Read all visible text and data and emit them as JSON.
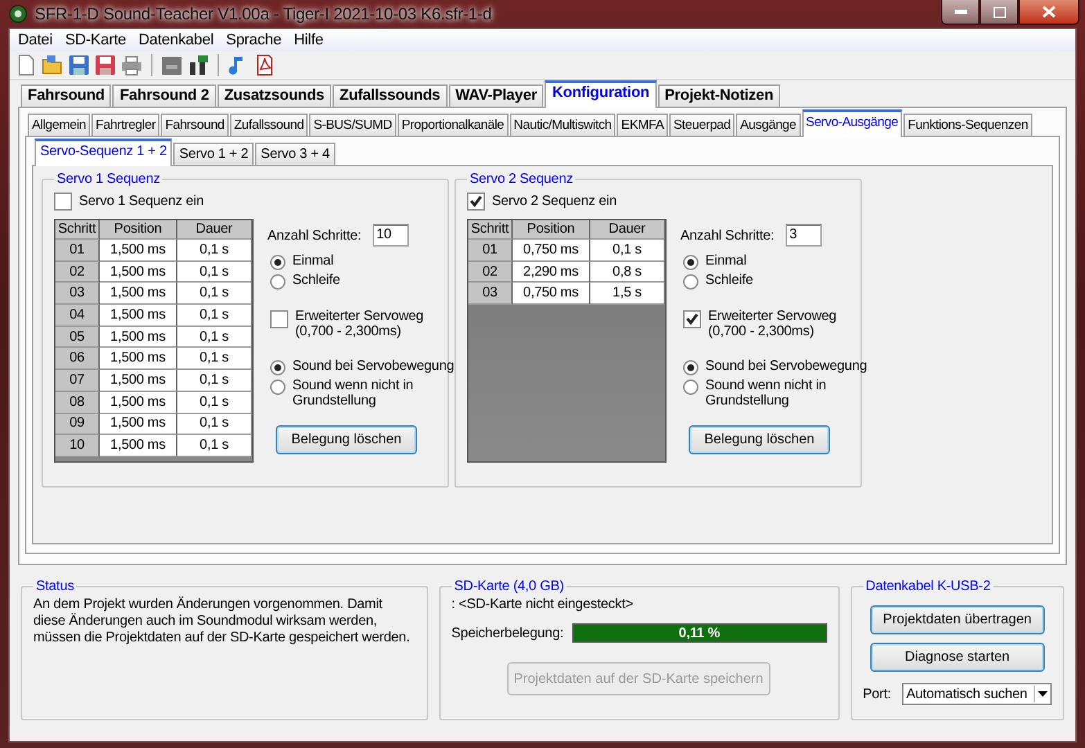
{
  "window": {
    "title": "SFR-1-D Sound-Teacher V1.00a - Tiger-I 2021-10-03 K6.sfr-1-d"
  },
  "menu": [
    {
      "label": "Datei"
    },
    {
      "label": "SD-Karte"
    },
    {
      "label": "Datenkabel"
    },
    {
      "label": "Sprache"
    },
    {
      "label": "Hilfe"
    }
  ],
  "main_tabs": [
    {
      "label": "Fahrsound",
      "selected": false
    },
    {
      "label": "Fahrsound 2",
      "selected": false
    },
    {
      "label": "Zusatzsounds",
      "selected": false
    },
    {
      "label": "Zufallssounds",
      "selected": false
    },
    {
      "label": "WAV-Player",
      "selected": false
    },
    {
      "label": "Konfiguration",
      "selected": true
    },
    {
      "label": "Projekt-Notizen",
      "selected": false
    }
  ],
  "sub_tabs": [
    {
      "label": "Allgemein",
      "selected": false
    },
    {
      "label": "Fahrtregler",
      "selected": false
    },
    {
      "label": "Fahrsound",
      "selected": false
    },
    {
      "label": "Zufallssound",
      "selected": false
    },
    {
      "label": "S-BUS/SUMD",
      "selected": false
    },
    {
      "label": "Proportionalkanäle",
      "selected": false
    },
    {
      "label": "Nautic/Multiswitch",
      "selected": false
    },
    {
      "label": "EKMFA",
      "selected": false
    },
    {
      "label": "Steuerpad",
      "selected": false
    },
    {
      "label": "Ausgänge",
      "selected": false
    },
    {
      "label": "Servo-Ausgänge",
      "selected": true
    },
    {
      "label": "Funktions-Sequenzen",
      "selected": false
    }
  ],
  "servo_tabs": [
    {
      "label": "Servo-Sequenz  1 + 2",
      "selected": true
    },
    {
      "label": "Servo 1 + 2",
      "selected": false
    },
    {
      "label": "Servo 3 + 4",
      "selected": false
    }
  ],
  "servo_groups": [
    {
      "title": "Servo 1 Sequenz",
      "enable": {
        "label": "Servo 1 Sequenz ein",
        "checked": false
      },
      "columns": [
        "Schritt",
        "Position",
        "Dauer"
      ],
      "rows": [
        {
          "step": "01",
          "position": "1,500 ms",
          "duration": "0,1 s"
        },
        {
          "step": "02",
          "position": "1,500 ms",
          "duration": "0,1 s"
        },
        {
          "step": "03",
          "position": "1,500 ms",
          "duration": "0,1 s"
        },
        {
          "step": "04",
          "position": "1,500 ms",
          "duration": "0,1 s"
        },
        {
          "step": "05",
          "position": "1,500 ms",
          "duration": "0,1 s"
        },
        {
          "step": "06",
          "position": "1,500 ms",
          "duration": "0,1 s"
        },
        {
          "step": "07",
          "position": "1,500 ms",
          "duration": "0,1 s"
        },
        {
          "step": "08",
          "position": "1,500 ms",
          "duration": "0,1 s"
        },
        {
          "step": "09",
          "position": "1,500 ms",
          "duration": "0,1 s"
        },
        {
          "step": "10",
          "position": "1,500 ms",
          "duration": "0,1 s"
        }
      ],
      "steps_label": "Anzahl Schritte:",
      "steps_value": "10",
      "mode_options": [
        {
          "label": "Einmal",
          "selected": true
        },
        {
          "label": "Schleife",
          "selected": false
        }
      ],
      "extended": {
        "label": "Erweiterter Servoweg (0,700 - 2,300ms)",
        "checked": false
      },
      "sound_options": [
        {
          "label": "Sound bei Servobewegung",
          "selected": true
        },
        {
          "label": "Sound wenn nicht in Grundstellung",
          "selected": false
        }
      ],
      "clear_button": "Belegung löschen"
    },
    {
      "title": "Servo 2 Sequenz",
      "enable": {
        "label": "Servo 2 Sequenz ein",
        "checked": true
      },
      "columns": [
        "Schritt",
        "Position",
        "Dauer"
      ],
      "rows": [
        {
          "step": "01",
          "position": "0,750 ms",
          "duration": "0,1 s"
        },
        {
          "step": "02",
          "position": "2,290 ms",
          "duration": "0,8 s"
        },
        {
          "step": "03",
          "position": "0,750 ms",
          "duration": "1,5 s"
        }
      ],
      "steps_label": "Anzahl Schritte:",
      "steps_value": "3",
      "mode_options": [
        {
          "label": "Einmal",
          "selected": true
        },
        {
          "label": "Schleife",
          "selected": false
        }
      ],
      "extended": {
        "label": "Erweiterter Servoweg (0,700 - 2,300ms)",
        "checked": true
      },
      "sound_options": [
        {
          "label": "Sound bei Servobewegung",
          "selected": true
        },
        {
          "label": "Sound wenn nicht in Grundstellung",
          "selected": false
        }
      ],
      "clear_button": "Belegung löschen"
    }
  ],
  "status": {
    "title": "Status",
    "text": "An dem Projekt wurden Änderungen vorgenommen. Damit diese Änderungen auch im Soundmodul wirksam werden, müssen die Projektdaten auf der SD-Karte gespeichert werden."
  },
  "sd_card": {
    "title": "SD-Karte (4,0 GB)",
    "info": ": <SD-Karte nicht eingesteckt>",
    "usage_label": "Speicherbelegung:",
    "usage": {
      "level": 1,
      "reading": "0,11 %"
    },
    "save_button": {
      "label": "Projektdaten auf der SD-Karte speichern",
      "disabled": true
    }
  },
  "cable": {
    "title": "Datenkabel K-USB-2",
    "buttons": [
      "Projektdaten übertragen",
      "Diagnose starten"
    ],
    "port_label": "Port:",
    "port_value": "Automatisch suchen"
  }
}
